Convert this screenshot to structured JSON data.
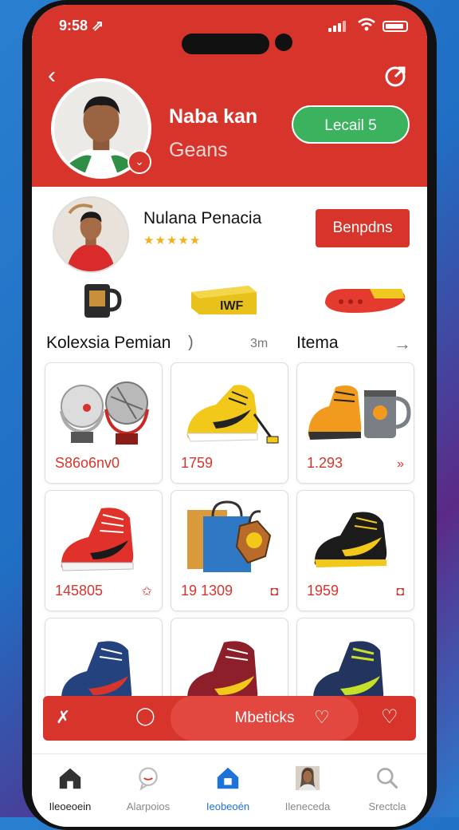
{
  "status": {
    "time": "9:58 ⇗"
  },
  "header": {
    "back_icon": "‹",
    "profile_name": "Naba kan",
    "profile_sub": "Geans",
    "action_button": "Lecail 5",
    "badge_icon": "⌄"
  },
  "seller": {
    "name": "Nulana Penacia",
    "stars": "★★★★★",
    "button": "Benpdns"
  },
  "section": {
    "title": "Kolexsia Pemian",
    "caret": ")",
    "count": "3m",
    "items_label": "Itema",
    "arrow": "→"
  },
  "products": [
    {
      "price": "S86o6nv0",
      "icon": ""
    },
    {
      "price": "1759",
      "icon": ""
    },
    {
      "price": "1.293",
      "icon": "»"
    },
    {
      "price": "145805",
      "icon": "✩"
    },
    {
      "price": "19 1309",
      "icon": "◘"
    },
    {
      "price": "1959",
      "icon": "◘"
    },
    {
      "price": "",
      "icon": ""
    },
    {
      "price": "",
      "icon": ""
    },
    {
      "price": "",
      "icon": ""
    }
  ],
  "action_bar": {
    "left_icon": "✗",
    "chat_icon": "◯",
    "label": "Mbeticks",
    "heart_icon": "♡",
    "heart2_icon": "♡"
  },
  "tabs": [
    {
      "label": "Ileoeoein",
      "icon": "home-icon"
    },
    {
      "label": "Alarpoios",
      "icon": "chat-icon"
    },
    {
      "label": "Ieobeoén",
      "icon": "house-active-icon"
    },
    {
      "label": "Ileneceda",
      "icon": "avatar-icon"
    },
    {
      "label": "Srectcla",
      "icon": "search-icon"
    }
  ],
  "colors": {
    "primary": "#d7352c",
    "accent_green": "#3ab25e",
    "active_tab": "#1e73d8"
  }
}
